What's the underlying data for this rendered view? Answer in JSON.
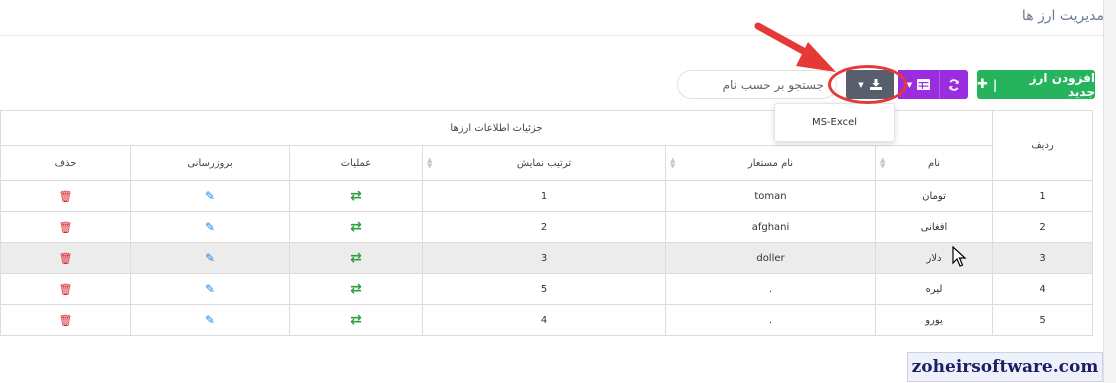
{
  "page": {
    "title": "مدیریت ارز ها"
  },
  "toolbar": {
    "add_label": "افزودن ارز جدید",
    "add_icon": "plus-icon",
    "refresh_icon": "refresh-icon",
    "columns_icon": "columns-icon",
    "export_icon": "download-icon",
    "search_placeholder": "جستجو بر حسب نام",
    "colors": {
      "add": "#25b35c",
      "purple": "#9b2de1",
      "export": "#575f6c",
      "highlight": "#e53935"
    }
  },
  "export_menu": {
    "items": [
      "MS-Excel"
    ]
  },
  "table": {
    "group_header": "جزئیات اطلاعات ارزها",
    "row_header": "ردیف",
    "columns": [
      "حذف",
      "بروزرسانی",
      "عملیات",
      "ترتیب نمایش",
      "نام مستعار",
      "نام"
    ],
    "rows": [
      {
        "no": "1",
        "name": "تومان",
        "alias": "toman",
        "order": "1"
      },
      {
        "no": "2",
        "name": "افغانی",
        "alias": "afghani",
        "order": "2"
      },
      {
        "no": "3",
        "name": "دلار",
        "alias": "doller",
        "order": "3"
      },
      {
        "no": "4",
        "name": "لیره",
        "alias": ".",
        "order": "5"
      },
      {
        "no": "5",
        "name": "یورو",
        "alias": ".",
        "order": "4"
      }
    ],
    "icons": {
      "delete": "trash-icon",
      "edit": "edit-icon",
      "ops": "swap-icon"
    }
  },
  "watermark": "zoheirsoftware.com"
}
